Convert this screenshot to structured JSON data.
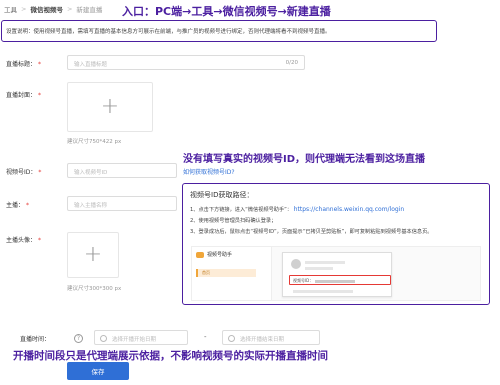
{
  "breadcrumb": {
    "items": [
      "工具",
      "微信视频号",
      "新建直播"
    ],
    "separator": ">"
  },
  "annotations": {
    "entry": "入口：PC端→工具→微信视频号→新建直播",
    "id_warning": "没有填写真实的视频号ID，则代理端无法看到这场直播",
    "time_note": "开播时间段只是代理端展示依据，不影响视频号的实际开播直播时间"
  },
  "notice": "设置说明：使用视频号直播，需填写直播的基本信息方可展示在前端，与推广员的视频号进行绑定，否则代理端将看不到视频号直播。",
  "form": {
    "title": {
      "label": "直播标题：",
      "placeholder": "输入直播标题",
      "counter": "0/20"
    },
    "cover": {
      "label": "直播封面：",
      "hint": "建议尺寸750*422 px"
    },
    "video_id": {
      "label": "视频号ID：",
      "placeholder": "输入视频号ID",
      "help_link": "如何获取视频号ID?"
    },
    "host": {
      "label": "主播：",
      "placeholder": "输入主播名称"
    },
    "avatar": {
      "label": "主播头像：",
      "hint": "建议尺寸300*300 px"
    },
    "time": {
      "label": "直播时间：",
      "start_placeholder": "选择开播开始日期",
      "end_placeholder": "选择开播结束日期",
      "dash": "-"
    },
    "save_label": "保存"
  },
  "popup": {
    "title": "视频号ID获取路径：",
    "steps": [
      "1、点击下方链接，进入“微信视频号助手”：",
      "2、使用视频号管理员扫码确认登录；",
      "3、登录成功后，鼠标点击“视频号ID”，页面提示“已拷贝至剪贴板”，即可复制粘贴到视频号基本信息页。"
    ],
    "url": "https://channels.weixin.qq.com/login",
    "screenshot": {
      "app_name": "视频号助手",
      "menu_item": "首页",
      "id_label": "视频号ID："
    }
  },
  "colors": {
    "accent": "#4b1fa0",
    "primary": "#2f6fd6",
    "required": "#e53935"
  }
}
